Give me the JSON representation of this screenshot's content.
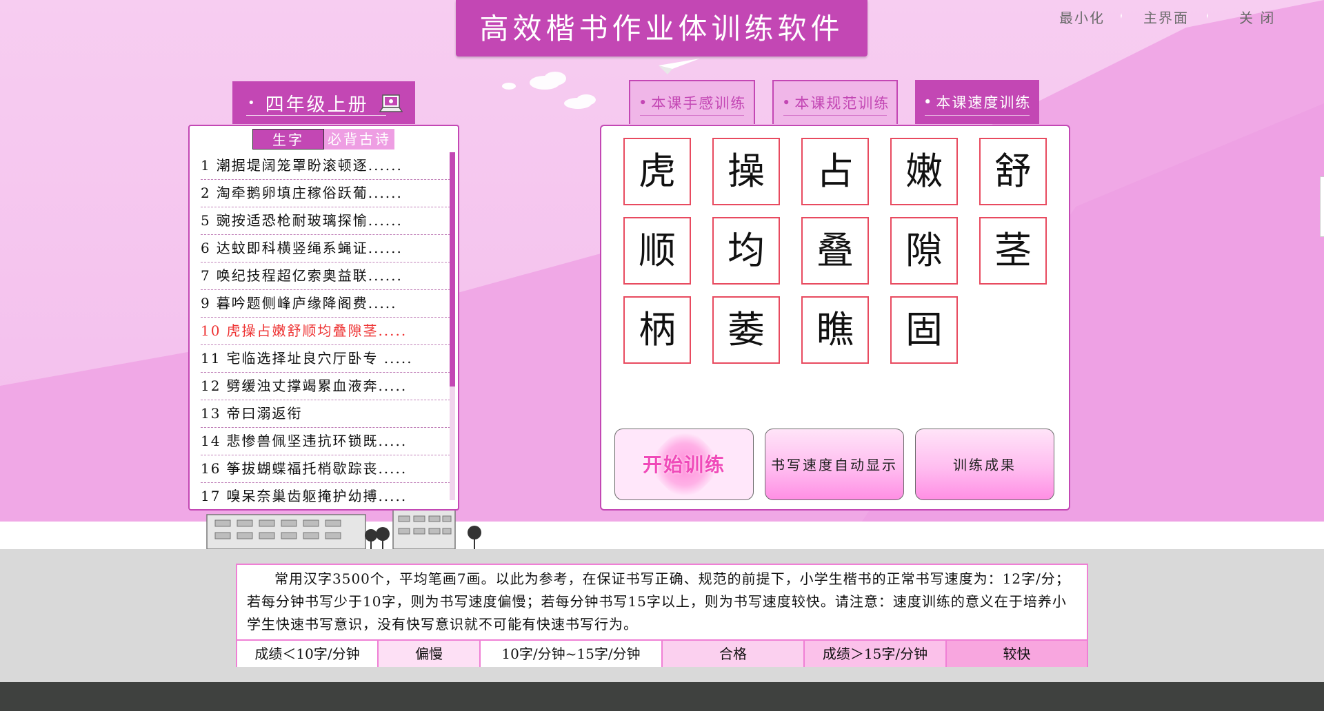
{
  "app": {
    "title": "高效楷书作业体训练软件"
  },
  "window_controls": {
    "minimize": "最小化",
    "home": "主界面",
    "close": "关 闭"
  },
  "grade": {
    "label": "四年级上册"
  },
  "subtabs": {
    "chars": "生字",
    "poems": "必背古诗"
  },
  "lessons": [
    {
      "num": "1",
      "chars": "潮据堤阔笼罩盼滚顿逐......"
    },
    {
      "num": "2",
      "chars": "淘牵鹅卵填庄稼俗跃葡......"
    },
    {
      "num": "5",
      "chars": "豌按适恐枪耐玻璃探愉......"
    },
    {
      "num": "6",
      "chars": "达蚊即科横竖绳系蝇证......"
    },
    {
      "num": "7",
      "chars": "唤纪技程超亿索奥益联......"
    },
    {
      "num": "9",
      "chars": "暮吟题侧峰庐缘降阁费....."
    },
    {
      "num": "10",
      "chars": "虎操占嫩舒顺均叠隙茎....."
    },
    {
      "num": "11",
      "chars": "宅临选择址良穴厅卧专 ....."
    },
    {
      "num": "12",
      "chars": "劈缓浊丈撑竭累血液奔....."
    },
    {
      "num": "13",
      "chars": "帝曰溺返衔"
    },
    {
      "num": "14",
      "chars": "悲惨兽佩坚违抗环锁既....."
    },
    {
      "num": "16",
      "chars": "筝拔蝴蝶福托梢歇踪丧....."
    },
    {
      "num": "17",
      "chars": "嗅呆奈巢齿躯掩护幼搏....."
    }
  ],
  "current_lesson": "10",
  "mode_tabs": {
    "feel": "本课手感训练",
    "norm": "本课规范训练",
    "speed": "本课速度训练"
  },
  "characters": [
    "虎",
    "操",
    "占",
    "嫩",
    "舒",
    "顺",
    "均",
    "叠",
    "隙",
    "茎",
    "柄",
    "萎",
    "瞧",
    "固"
  ],
  "buttons": {
    "start": "开始训练",
    "speed_display": "书写速度自动显示",
    "results": "训练成果"
  },
  "info": {
    "text": "常用汉字3500个，平均笔画7画。以此为参考，在保证书写正确、规范的前提下，小学生楷书的正常书写速度为：12字/分；若每分钟书写少于10字，则为书写速度偏慢；若每分钟书写15字以上，则为书写速度较快。请注意：速度训练的意义在于培养小学生快速书写意识，没有快写意识就不可能有快速书写行为。",
    "scores": [
      "成绩＜10字/分钟",
      "偏慢",
      "10字/分钟~15字/分钟",
      "合格",
      "成绩＞15字/分钟",
      "较快"
    ]
  },
  "colors": {
    "accent": "#c347b4",
    "cell_border": "#e84a5f",
    "current_lesson": "#ee3333"
  }
}
